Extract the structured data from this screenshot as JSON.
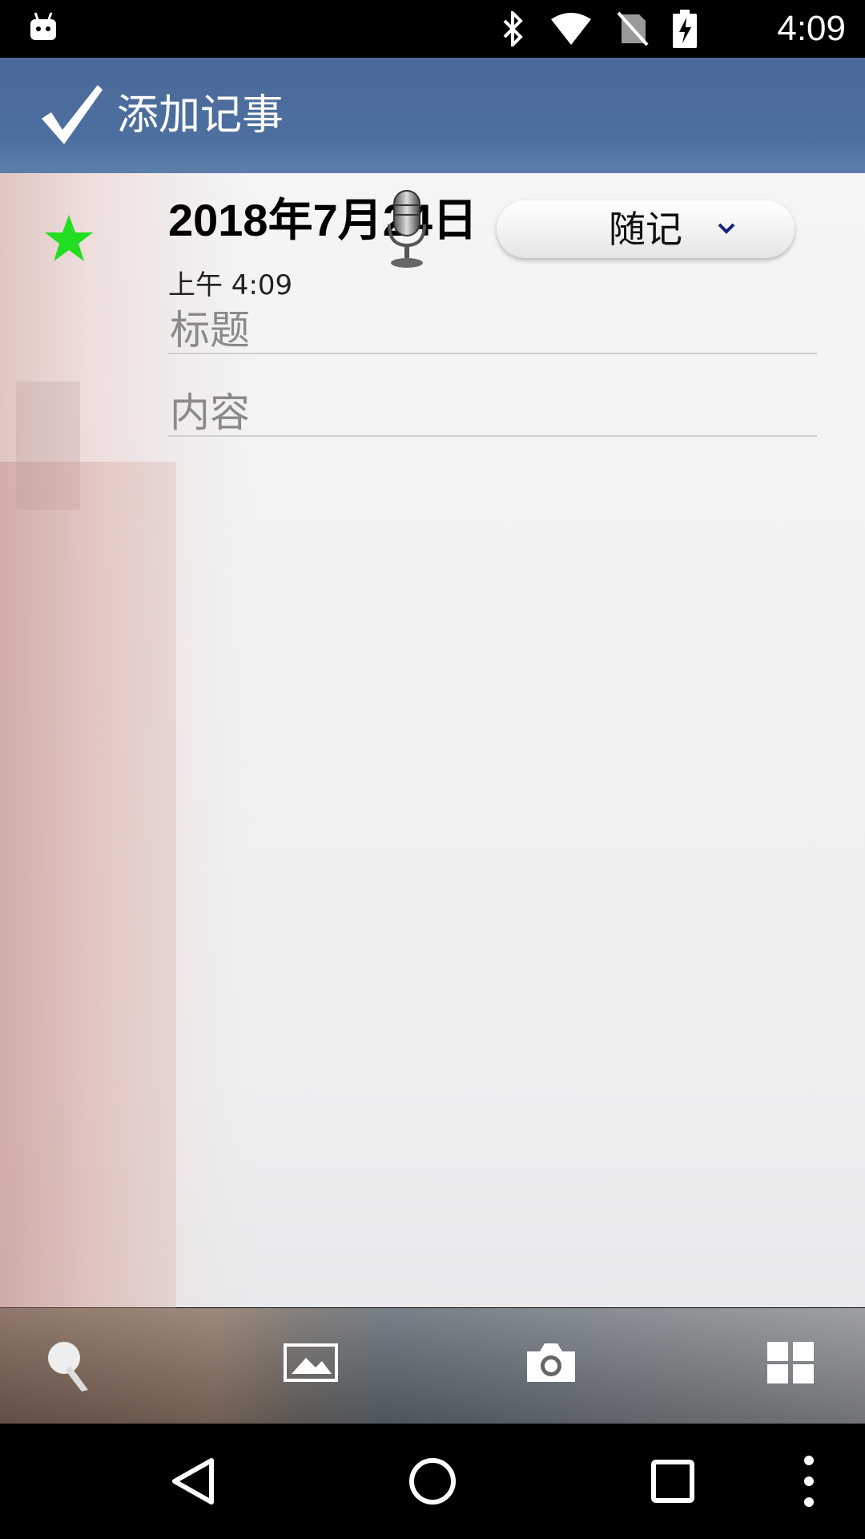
{
  "status_bar": {
    "time": "4:09",
    "icons": [
      "android-icon",
      "bluetooth-icon",
      "wifi-icon",
      "no-sim-icon",
      "battery-charging-icon"
    ]
  },
  "app_bar": {
    "title": "添加记事",
    "confirm_icon": "checkmark-icon"
  },
  "note": {
    "date": "2018年7月24日",
    "time": "上午 4:09",
    "favorite_color": "#22dd22",
    "category": {
      "selected": "随记"
    },
    "title_placeholder": "标题",
    "content_placeholder": "内容"
  },
  "toolbar": {
    "buttons": [
      "brush-icon",
      "image-icon",
      "camera-icon",
      "grid-icon"
    ]
  },
  "navigation": {
    "buttons": [
      "back-icon",
      "home-icon",
      "recents-icon",
      "more-icon"
    ]
  }
}
